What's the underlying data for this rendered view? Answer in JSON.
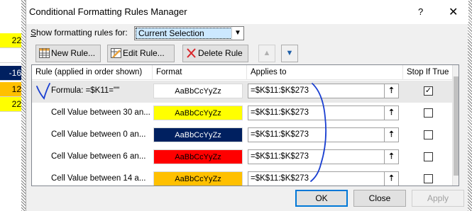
{
  "excel_cells": [
    {
      "value": "22",
      "bg": "#ffff00",
      "color": "#000000"
    },
    {
      "value": "",
      "bg": "#ffffff",
      "color": "#000000"
    },
    {
      "value": "-16",
      "bg": "#002060",
      "color": "#ffffff"
    },
    {
      "value": "12",
      "bg": "#ffc000",
      "color": "#000000"
    },
    {
      "value": "22",
      "bg": "#ffff00",
      "color": "#000000"
    }
  ],
  "dialog": {
    "title": "Conditional Formatting Rules Manager",
    "help": "?",
    "close_icon": "close-x"
  },
  "show_rules": {
    "label": "Show formatting rules for:",
    "value": "Current Selection"
  },
  "toolbar": {
    "new_rule": "New Rule...",
    "edit_rule": "Edit Rule...",
    "delete_rule": "Delete Rule"
  },
  "table": {
    "headers": {
      "rule": "Rule (applied in order shown)",
      "format": "Format",
      "applies": "Applies to",
      "stop": "Stop If True"
    },
    "rows": [
      {
        "rule": "Formula: =$K11=\"\"",
        "preview": "AaBbCcYyZz",
        "bg": "#ffffff",
        "fg": "#000000",
        "applies": "=$K$11:$K$273",
        "stop": true,
        "selected": true
      },
      {
        "rule": "Cell Value between 30 an...",
        "preview": "AaBbCcYyZz",
        "bg": "#ffff00",
        "fg": "#000000",
        "applies": "=$K$11:$K$273",
        "stop": false,
        "selected": false
      },
      {
        "rule": "Cell Value between 0 an...",
        "preview": "AaBbCcYyZz",
        "bg": "#002060",
        "fg": "#ffffff",
        "applies": "=$K$11:$K$273",
        "stop": false,
        "selected": false
      },
      {
        "rule": "Cell Value between 6 an...",
        "preview": "AaBbCcYyZz",
        "bg": "#ff0000",
        "fg": "#000000",
        "applies": "=$K$11:$K$273",
        "stop": false,
        "selected": false
      },
      {
        "rule": "Cell Value between 14 a...",
        "preview": "AaBbCcYyZz",
        "bg": "#ffc000",
        "fg": "#000000",
        "applies": "=$K$11:$K$273",
        "stop": false,
        "selected": false
      }
    ]
  },
  "footer": {
    "ok": "OK",
    "close": "Close",
    "apply": "Apply"
  },
  "ink_color": "#1a3fd1"
}
